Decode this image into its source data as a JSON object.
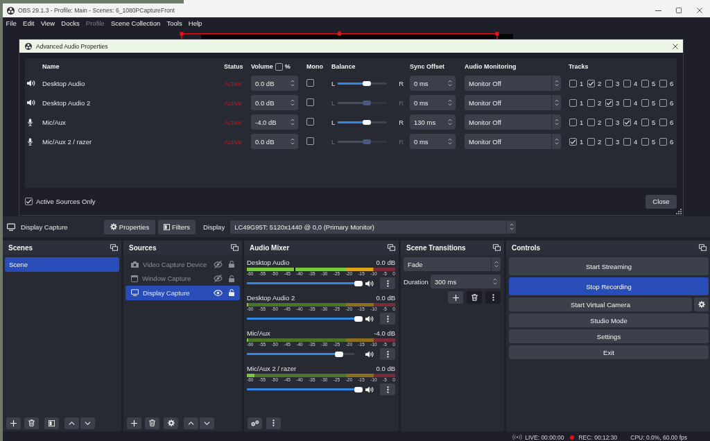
{
  "window": {
    "title": "OBS 29.1.3 - Profile: Main - Scenes: 6_1080PCaptureFront"
  },
  "menu": [
    {
      "label": "File",
      "disabled": false
    },
    {
      "label": "Edit",
      "disabled": false
    },
    {
      "label": "View",
      "disabled": false
    },
    {
      "label": "Docks",
      "disabled": false
    },
    {
      "label": "Profile",
      "disabled": true
    },
    {
      "label": "Scene Collection",
      "disabled": false
    },
    {
      "label": "Tools",
      "disabled": false
    },
    {
      "label": "Help",
      "disabled": false
    }
  ],
  "advanced_audio_dialog": {
    "title": "Advanced Audio Properties",
    "columns": [
      {
        "label": "Name"
      },
      {
        "label": "Status"
      },
      {
        "label": "Volume",
        "toggle": {
          "label": "%",
          "checked": false
        }
      },
      {
        "label": "Mono"
      },
      {
        "label": "Balance"
      },
      {
        "label": "Sync Offset"
      },
      {
        "label": "Audio Monitoring"
      },
      {
        "label": "Tracks"
      }
    ],
    "sources": [
      {
        "kind": "output",
        "name": "Desktop Audio",
        "status": "Active",
        "volume": "0.0 dB",
        "mono": false,
        "balance": {
          "left_label": "L",
          "right_label": "R",
          "level": 0.5,
          "disabled": false
        },
        "sync_offset": "0 ms",
        "monitoring": "Monitor Off",
        "tracks": [
          {
            "label": "1",
            "checked": false
          },
          {
            "label": "2",
            "checked": true
          },
          {
            "label": "3",
            "checked": false
          },
          {
            "label": "4",
            "checked": false
          },
          {
            "label": "5",
            "checked": false
          },
          {
            "label": "6",
            "checked": false
          }
        ]
      },
      {
        "kind": "output",
        "name": "Desktop Audio 2",
        "status": "Active",
        "volume": "0.0 dB",
        "mono": false,
        "balance": {
          "left_label": "L",
          "right_label": "R",
          "level": 0.5,
          "disabled": true
        },
        "sync_offset": "0 ms",
        "monitoring": "Monitor Off",
        "tracks": [
          {
            "label": "1",
            "checked": false
          },
          {
            "label": "2",
            "checked": false
          },
          {
            "label": "3",
            "checked": true
          },
          {
            "label": "4",
            "checked": false
          },
          {
            "label": "5",
            "checked": false
          },
          {
            "label": "6",
            "checked": false
          }
        ]
      },
      {
        "kind": "input",
        "name": "Mic/Aux",
        "status": "Active",
        "volume": "-4.0 dB",
        "mono": false,
        "balance": {
          "left_label": "L",
          "right_label": "R",
          "level": 0.5,
          "disabled": false
        },
        "sync_offset": "130 ms",
        "monitoring": "Monitor Off",
        "tracks": [
          {
            "label": "1",
            "checked": false
          },
          {
            "label": "2",
            "checked": false
          },
          {
            "label": "3",
            "checked": false
          },
          {
            "label": "4",
            "checked": true
          },
          {
            "label": "5",
            "checked": false
          },
          {
            "label": "6",
            "checked": false
          }
        ]
      },
      {
        "kind": "input",
        "name": "Mic/Aux 2 / razer",
        "status": "Active",
        "volume": "0.0 dB",
        "mono": false,
        "balance": {
          "left_label": "L",
          "right_label": "R",
          "level": 0.5,
          "disabled": true
        },
        "sync_offset": "0 ms",
        "monitoring": "Monitor Off",
        "tracks": [
          {
            "label": "1",
            "checked": true
          },
          {
            "label": "2",
            "checked": false
          },
          {
            "label": "3",
            "checked": false
          },
          {
            "label": "4",
            "checked": false
          },
          {
            "label": "5",
            "checked": false
          },
          {
            "label": "6",
            "checked": false
          }
        ]
      }
    ],
    "active_sources_only": {
      "label": "Active Sources Only",
      "checked": true
    },
    "close_button": "Close"
  },
  "source_toolbar": {
    "source": "Display Capture",
    "buttons": [
      {
        "kind": "properties",
        "label": "Properties"
      },
      {
        "kind": "filters",
        "label": "Filters"
      }
    ],
    "display_label": "Display",
    "display": "LC49G95T: 5120x1440 @ 0,0 (Primary Monitor)"
  },
  "docks": [
    {
      "kind": "scenes",
      "title": "Scenes",
      "items": [
        {
          "label": "Scene",
          "selected": true
        }
      ]
    },
    {
      "kind": "sources",
      "title": "Sources",
      "items": [
        {
          "kind": "camera",
          "label": "Video Capture Device",
          "visible": false,
          "locked": false,
          "selected": false
        },
        {
          "kind": "window",
          "label": "Window Capture",
          "visible": false,
          "locked": false,
          "selected": false
        },
        {
          "kind": "display",
          "label": "Display Capture",
          "visible": true,
          "locked": false,
          "selected": true
        }
      ]
    },
    {
      "kind": "mixer",
      "title": "Audio Mixer",
      "channels": [
        {
          "name": "Desktop Audio",
          "reading": "0.0 dB",
          "meter": {
            "level": 0.85,
            "peak": {
              "level": 0.32
            }
          },
          "scale": [
            "-60",
            "-55",
            "-50",
            "-45",
            "-40",
            "-35",
            "-30",
            "-25",
            "-20",
            "-15",
            "-10",
            "-5",
            "0"
          ],
          "volume": {
            "level": 1.0
          },
          "muted": false
        },
        {
          "name": "Desktop Audio 2",
          "reading": "0.0 dB",
          "meter": {
            "level": 0.01,
            "peak": {
              "level": 0
            }
          },
          "scale": [
            "-60",
            "-55",
            "-50",
            "-45",
            "-40",
            "-35",
            "-30",
            "-25",
            "-20",
            "-15",
            "-10",
            "-5",
            "0"
          ],
          "volume": {
            "level": 1.0
          },
          "muted": false
        },
        {
          "name": "Mic/Aux",
          "reading": "-4.0 dB",
          "meter": {
            "level": 0.01,
            "peak": {
              "level": 0
            }
          },
          "scale": [
            "-60",
            "-55",
            "-50",
            "-45",
            "-40",
            "-35",
            "-30",
            "-25",
            "-20",
            "-15",
            "-10",
            "-5",
            "0"
          ],
          "volume": {
            "level": 0.82
          },
          "muted": false
        },
        {
          "name": "Mic/Aux 2 / razer",
          "reading": "0.0 dB",
          "meter": {
            "level": 0.05,
            "peak": {
              "level": 0
            }
          },
          "scale": [
            "-60",
            "-55",
            "-50",
            "-45",
            "-40",
            "-35",
            "-30",
            "-25",
            "-20",
            "-15",
            "-10",
            "-5",
            "0"
          ],
          "volume": {
            "level": 1.0
          },
          "muted": false
        }
      ]
    },
    {
      "kind": "transitions",
      "title": "Scene Transitions",
      "transition": "Fade",
      "duration_label": "Duration",
      "duration": "300 ms"
    },
    {
      "kind": "controls",
      "title": "Controls",
      "buttons": [
        {
          "label": "Start Streaming",
          "active": false,
          "settings": false
        },
        {
          "label": "Stop Recording",
          "active": true,
          "settings": false
        },
        {
          "label": "Start Virtual Camera",
          "active": false,
          "settings": true
        },
        {
          "label": "Studio Mode",
          "active": false,
          "settings": false
        },
        {
          "label": "Settings",
          "active": false,
          "settings": false
        },
        {
          "label": "Exit",
          "active": false,
          "settings": false
        }
      ]
    }
  ],
  "status_bar": {
    "live": "LIVE: 00:00:00",
    "rec": {
      "text": "REC: 00:12:30",
      "recording": true
    },
    "performance": "CPU: 0.0%, 60.00 fps"
  }
}
